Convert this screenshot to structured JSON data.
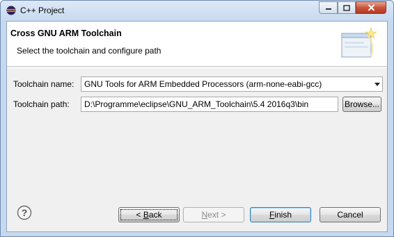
{
  "window": {
    "title": "C++ Project",
    "ghost_title": ""
  },
  "header": {
    "title": "Cross GNU ARM Toolchain",
    "description": "Select the toolchain and configure path"
  },
  "form": {
    "toolchain_name_label": "Toolchain name:",
    "toolchain_name_value": "GNU Tools for ARM Embedded Processors (arm-none-eabi-gcc)",
    "toolchain_path_label": "Toolchain path:",
    "toolchain_path_value": "D:\\Programme\\eclipse\\GNU_ARM_Toolchain\\5.4 2016q3\\bin",
    "browse_label": "Browse..."
  },
  "footer": {
    "back_prefix": "< ",
    "back_mnemonic": "B",
    "back_rest": "ack",
    "next_mnemonic": "N",
    "next_rest": "ext >",
    "finish_mnemonic": "F",
    "finish_rest": "inish",
    "cancel_label": "Cancel"
  }
}
